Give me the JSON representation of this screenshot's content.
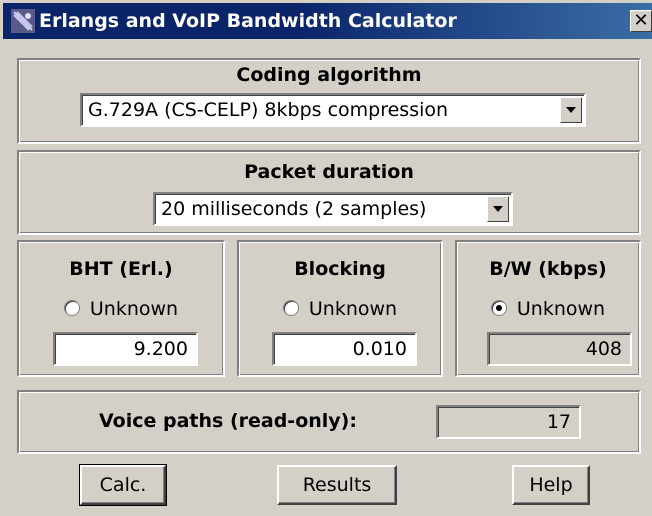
{
  "window": {
    "title": "Erlangs and VoIP Bandwidth Calculator",
    "close_label": "✕"
  },
  "coding": {
    "label": "Coding algorithm",
    "selected": "G.729A (CS-CELP) 8kbps compression"
  },
  "packet": {
    "label": "Packet duration",
    "selected": "20 milliseconds (2 samples)"
  },
  "bht": {
    "label": "BHT (Erl.)",
    "radio_label": "Unknown",
    "radio_checked": false,
    "value": "9.200"
  },
  "blocking": {
    "label": "Blocking",
    "radio_label": "Unknown",
    "radio_checked": false,
    "value": "0.010"
  },
  "bw": {
    "label": "B/W (kbps)",
    "radio_label": "Unknown",
    "radio_checked": true,
    "value": "408"
  },
  "voice": {
    "label": "Voice paths (read-only):",
    "value": "17"
  },
  "buttons": {
    "calc": "Calc.",
    "results": "Results",
    "help": "Help"
  },
  "colors": {
    "face": "#d4d0c8",
    "titlebar": "#0a246a"
  },
  "icons": {
    "app": "satellite-dish-icon",
    "dropdown": "chevron-down-icon"
  }
}
